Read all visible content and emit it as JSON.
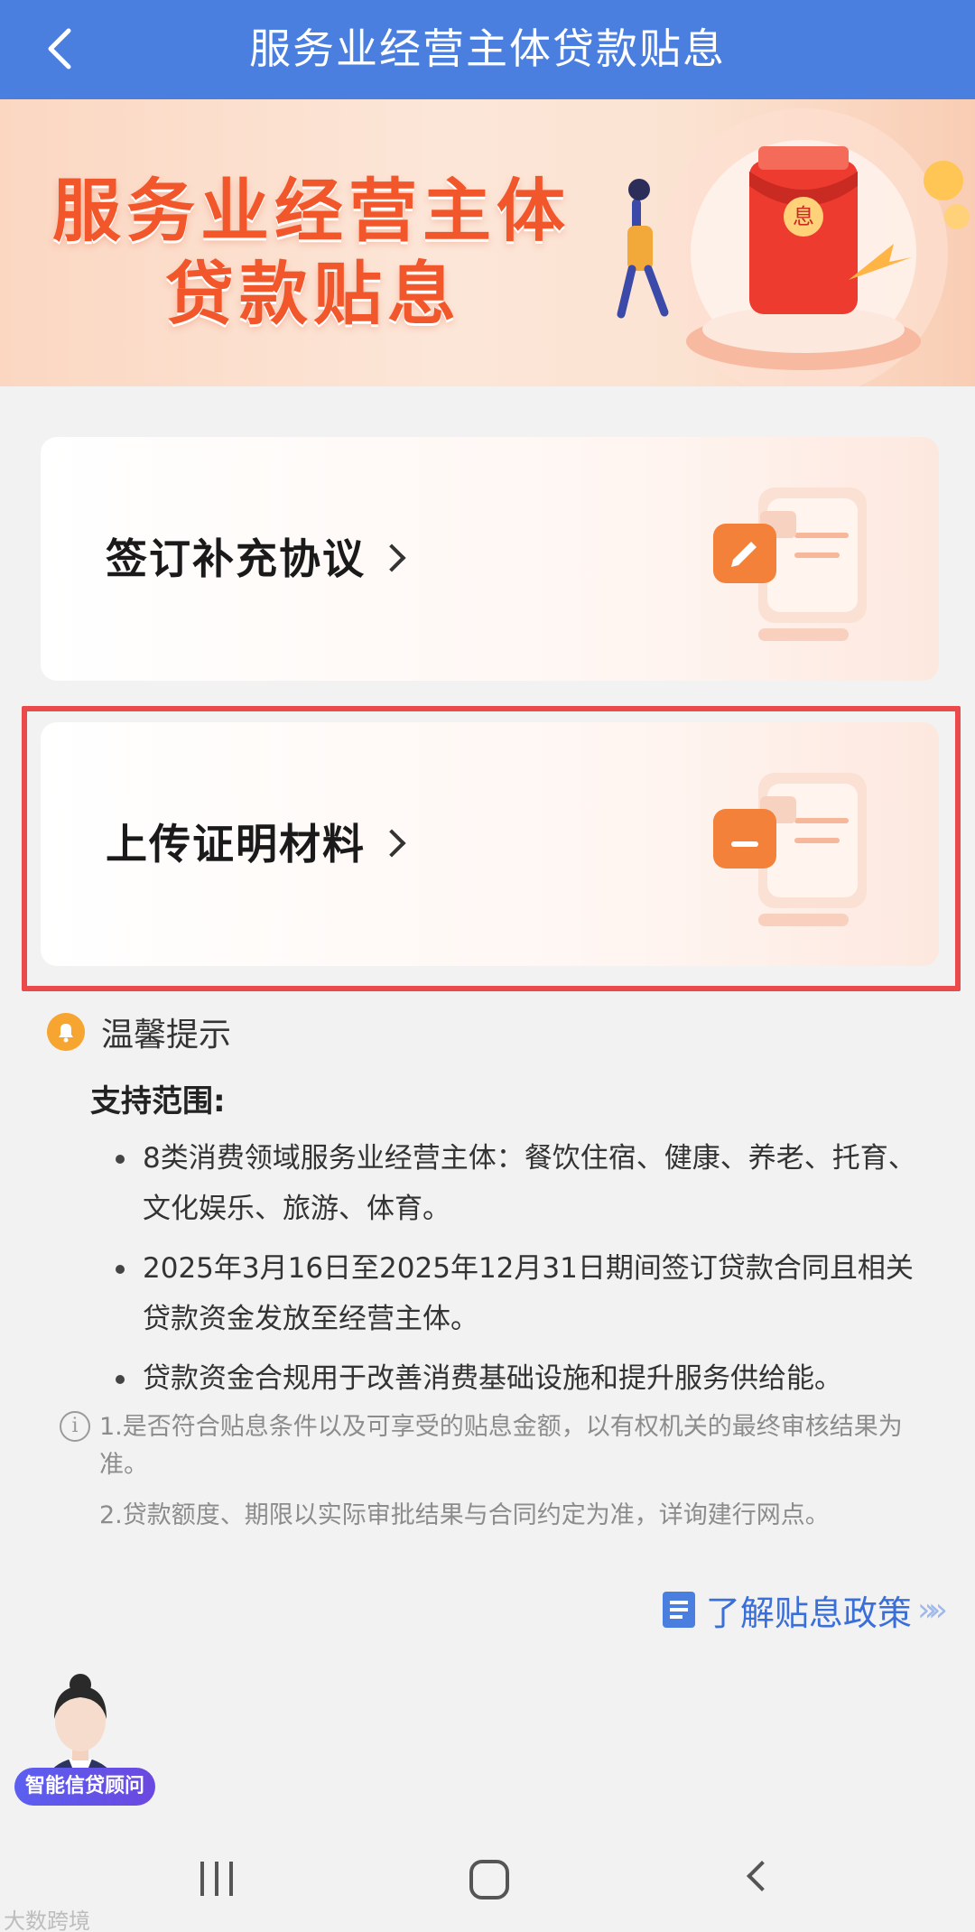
{
  "header": {
    "title": "服务业经营主体贷款贴息",
    "back_icon": "chevron-left-icon",
    "background_color": "#4a7fe0"
  },
  "banner": {
    "title_line1": "服务业经营主体",
    "title_line2": "贷款贴息",
    "title_color": "#f2562b"
  },
  "cards": [
    {
      "label": "签订补充协议",
      "icon": "edit-document-icon"
    },
    {
      "label": "上传证明材料",
      "icon": "upload-document-icon",
      "highlighted": true
    }
  ],
  "tips": {
    "title": "温馨提示",
    "scope_title": "支持范围:",
    "bullets": [
      "8类消费领域服务业经营主体：餐饮住宿、健康、养老、托育、文化娱乐、旅游、体育。",
      "2025年3月16日至2025年12月31日期间签订贷款合同且相关贷款资金发放至经营主体。",
      "贷款资金合规用于改善消费基础设施和提升服务供给能。"
    ],
    "notes": [
      "1.是否符合贴息条件以及可享受的贴息金额，以有权机关的最终审核结果为准。",
      "2.贷款额度、期限以实际审批结果与合同约定为准，详询建行网点。"
    ],
    "accent_color": "#f7a531"
  },
  "policy_link": {
    "label": "了解贴息政策",
    "arrows": "»»",
    "color": "#3a6fd8"
  },
  "advisor": {
    "label": "智能信贷顾问"
  },
  "watermark": "大数跨境"
}
